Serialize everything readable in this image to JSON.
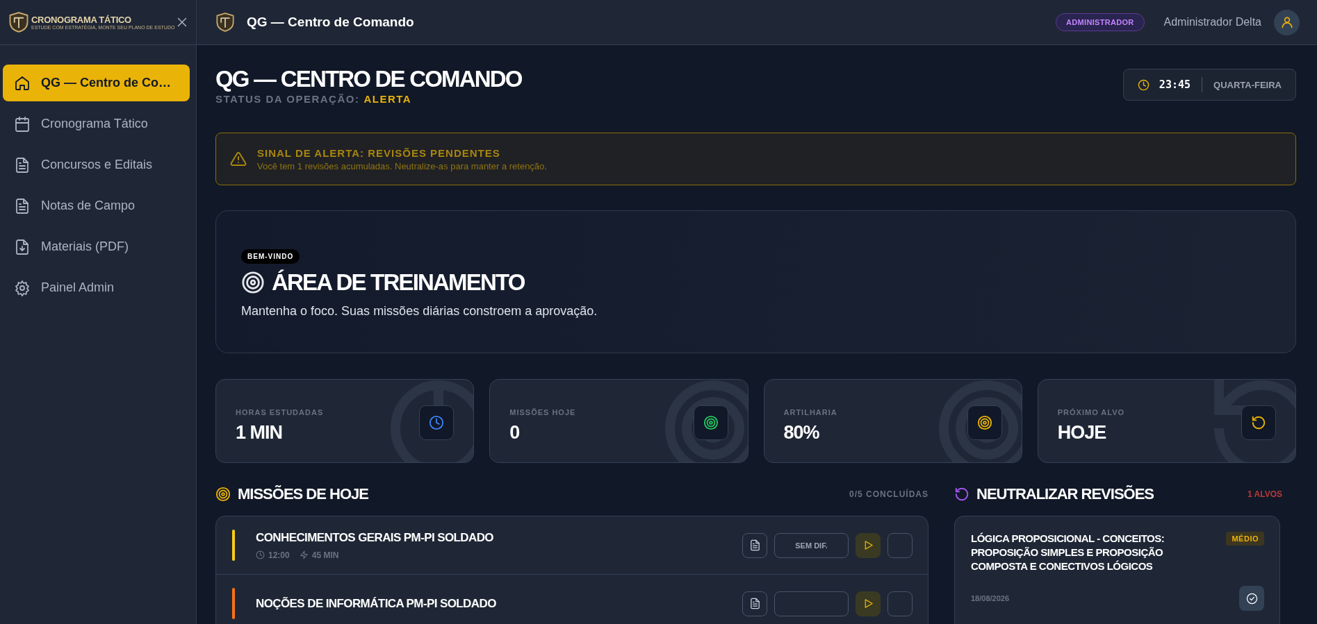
{
  "sidebar": {
    "logo": {
      "title": "CRONOGRAMA TÁTICO",
      "tagline": "ESTUDE COM ESTRATÉGIA, MONTE SEU PLANO DE ESTUDO"
    },
    "items": [
      {
        "label": "QG — Centro de Co…",
        "kind": "home",
        "selected": true
      },
      {
        "label": "Cronograma Tático",
        "kind": "calendar",
        "selected": false
      },
      {
        "label": "Concursos e Editais",
        "kind": "file",
        "selected": false
      },
      {
        "label": "Notas de Campo",
        "kind": "file",
        "selected": false
      },
      {
        "label": "Materiais (PDF)",
        "kind": "download",
        "selected": false
      },
      {
        "label": "Painel Admin",
        "kind": "gear",
        "selected": false
      }
    ]
  },
  "header": {
    "title": "QG — Centro de Comando",
    "role_badge": "ADMINISTRADOR",
    "user_name": "Administrador Delta"
  },
  "page": {
    "title": "QG — CENTRO DE COMANDO",
    "status_label": "STATUS DA OPERAÇÃO:",
    "status_value": "ALERTA",
    "clock": {
      "time": "23:45",
      "day": "QUARTA-FEIRA"
    }
  },
  "alert": {
    "title": "SINAL DE ALERTA: REVISÕES PENDENTES",
    "message": "Você tem 1 revisões acumuladas. Neutralize-as para manter a retenção."
  },
  "welcome": {
    "badge": "BEM-VINDO",
    "title": "ÁREA DE TREINAMENTO",
    "subtitle": "Mantenha o foco. Suas missões diárias constroem a aprovação."
  },
  "stats": [
    {
      "label": "HORAS ESTUDADAS",
      "value": "1 MIN",
      "kind": "clock",
      "color": "#3b82f6"
    },
    {
      "label": "MISSÕES HOJE",
      "value": "0",
      "kind": "target",
      "color": "#22c55e"
    },
    {
      "label": "ARTILHARIA",
      "value": "80%",
      "kind": "target",
      "color": "#eab308"
    },
    {
      "label": "PRÓXIMO ALVO",
      "value": "HOJE",
      "kind": "refresh",
      "color": "#eab308"
    }
  ],
  "missions": {
    "title": "MISSÕES DE HOJE",
    "count": "0/5 CONCLUÍDAS",
    "items": [
      {
        "title": "CONHECIMENTOS GERAIS PM-PI SOLDADO",
        "color": "#facc15",
        "time": "12:00",
        "duration": "45 MIN",
        "difficulty": "SEM DIF.",
        "checked": false
      },
      {
        "title": "NOÇÕES DE INFORMÁTICA PM-PI SOLDADO",
        "color": "#f97316",
        "checked": false
      }
    ]
  },
  "revisions": {
    "title": "NEUTRALIZAR REVISÕES",
    "count": "1 ALVOS",
    "items": [
      {
        "title": "LÓGICA PROPOSICIONAL - CONCEITOS: PROPOSIÇÃO SIMPLES E PROPOSIÇÃO COMPOSTA E CONECTIVOS LÓGICOS",
        "difficulty": "MÉDIO",
        "date": "18/08/2026"
      }
    ]
  }
}
